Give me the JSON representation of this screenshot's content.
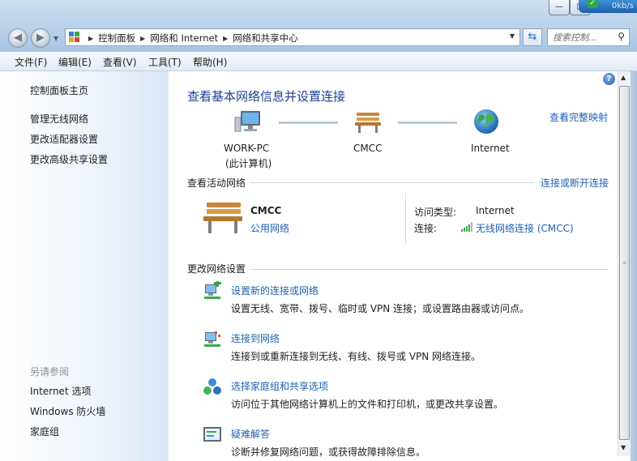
{
  "window": {
    "tray_speed": "0kb/s"
  },
  "address": {
    "crumbs": [
      "控制面板",
      "网络和 Internet",
      "网络和共享中心"
    ],
    "search_placeholder": "搜索控制..."
  },
  "menu": [
    "文件(F)",
    "编辑(E)",
    "查看(V)",
    "工具(T)",
    "帮助(H)"
  ],
  "sidebar": {
    "home": "控制面板主页",
    "links": [
      "管理无线网络",
      "更改适配器设置",
      "更改高级共享设置"
    ],
    "see_also_header": "另请参阅",
    "see_also": [
      "Internet 选项",
      "Windows 防火墙",
      "家庭组"
    ]
  },
  "main": {
    "title": "查看基本网络信息并设置连接",
    "full_map_link": "查看完整映射",
    "map": {
      "computer_name": "WORK-PC",
      "computer_sub": "(此计算机)",
      "network": "CMCC",
      "internet": "Internet"
    },
    "active": {
      "header": "查看活动网络",
      "connect_link": "连接或断开连接",
      "network_name": "CMCC",
      "network_type": "公用网络",
      "access_label": "访问类型:",
      "access_value": "Internet",
      "connection_label": "连接:",
      "connection_value": "无线网络连接 (CMCC)"
    },
    "change": {
      "header": "更改网络设置",
      "tasks": [
        {
          "title": "设置新的连接或网络",
          "desc": "设置无线、宽带、拨号、临时或 VPN 连接；或设置路由器或访问点。"
        },
        {
          "title": "连接到网络",
          "desc": "连接到或重新连接到无线、有线、拨号或 VPN 网络连接。"
        },
        {
          "title": "选择家庭组和共享选项",
          "desc": "访问位于其他网络计算机上的文件和打印机，或更改共享设置。"
        },
        {
          "title": "疑难解答",
          "desc": "诊断并修复网络问题，或获得故障排除信息。"
        }
      ]
    }
  },
  "colors": {
    "link": "#1f61b2",
    "title": "#1f3f93",
    "sidebar_gradient_end": "#dce8f6",
    "chrome": "#b9d1ea"
  }
}
